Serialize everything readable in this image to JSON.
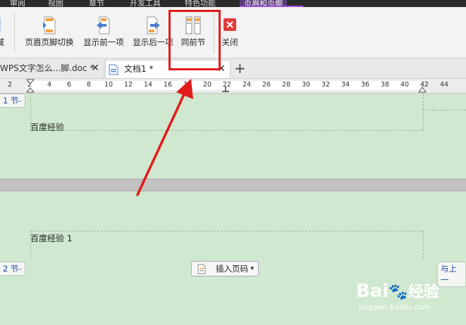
{
  "menu": {
    "tabs": [
      "审阅",
      "视图",
      "章节",
      "开发工具",
      "特色功能",
      "页眉和页脚"
    ],
    "active_tab": "页眉和页脚"
  },
  "ribbon": {
    "partial_left_label": "域",
    "buttons": [
      {
        "id": "switch",
        "label": "页眉页脚切换"
      },
      {
        "id": "prev",
        "label": "显示前一项"
      },
      {
        "id": "next",
        "label": "显示后一项"
      },
      {
        "id": "same",
        "label": "同前节"
      },
      {
        "id": "close",
        "label": "关闭"
      }
    ]
  },
  "doc_tabs": [
    {
      "title": "WPS文字怎么...脚.doc *",
      "active": false
    },
    {
      "title": "文档1 *",
      "active": true
    }
  ],
  "ruler": {
    "ticks": [
      "2",
      "2",
      "4",
      "6",
      "8",
      "10",
      "12",
      "14",
      "16",
      "18",
      "20",
      "22",
      "24",
      "26",
      "28",
      "30",
      "32",
      "34",
      "36",
      "38",
      "40",
      "42",
      "44"
    ]
  },
  "page1": {
    "section_tag": "1 节-",
    "header_text": "百度经验"
  },
  "page2": {
    "section_tag": "2 节-",
    "header_text": "百度经验 1",
    "right_tag": "与上一"
  },
  "insert_page_number": {
    "label": "插入页码"
  },
  "watermark": {
    "brand": "Bai",
    "brand2": "经验",
    "url": "jingyan.baidu.com"
  },
  "colors": {
    "highlight": "#e21b1b",
    "page_bg": "#cfe8cf",
    "accent": "#a34be0"
  }
}
